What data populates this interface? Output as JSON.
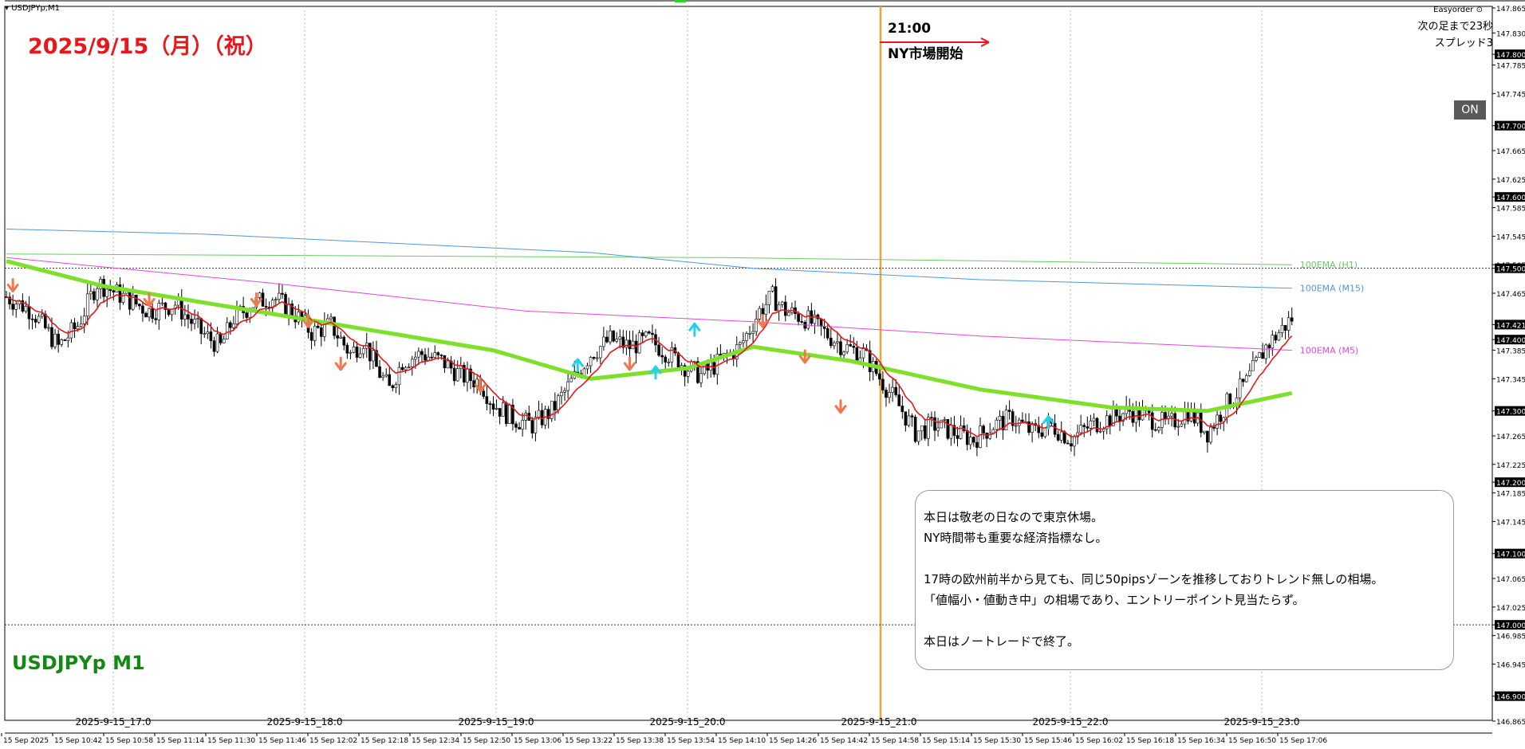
{
  "window": {
    "symbol_title": "USDJPYp,M1",
    "addon": "Easyorder"
  },
  "chart_data": {
    "type": "candlestick",
    "symbol": "USDJPYp",
    "timeframe": "M1",
    "ylim": [
      146.865,
      147.865
    ],
    "y_ticks": [
      "147.865",
      "147.830",
      "147.800",
      "147.785",
      "147.745",
      "147.700",
      "147.665",
      "147.625",
      "147.600",
      "147.585",
      "147.545",
      "147.505",
      "147.500",
      "147.465",
      "147.421",
      "147.400",
      "147.385",
      "147.345",
      "147.300",
      "147.265",
      "147.225",
      "147.200",
      "147.185",
      "147.145",
      "147.100",
      "147.065",
      "147.025",
      "147.000",
      "146.985",
      "146.945",
      "146.900",
      "146.865"
    ],
    "y_ticks_highlight": [
      "147.800",
      "147.700",
      "147.600",
      "147.500",
      "147.421",
      "147.400",
      "147.300",
      "147.200",
      "147.100",
      "147.000",
      "146.900"
    ],
    "x_ticks": [
      "15 Sep 2025",
      "15 Sep 10:42",
      "15 Sep 10:58",
      "15 Sep 11:14",
      "15 Sep 11:30",
      "15 Sep 11:46",
      "15 Sep 12:02",
      "15 Sep 12:18",
      "15 Sep 12:34",
      "15 Sep 12:50",
      "15 Sep 13:06",
      "15 Sep 13:22",
      "15 Sep 13:38",
      "15 Sep 13:54",
      "15 Sep 14:10",
      "15 Sep 14:26",
      "15 Sep 14:42",
      "15 Sep 14:58",
      "15 Sep 15:14",
      "15 Sep 15:30",
      "15 Sep 15:46",
      "15 Sep 16:02",
      "15 Sep 16:18",
      "15 Sep 16:34",
      "15 Sep 16:50",
      "15 Sep 17:06"
    ],
    "session_labels": [
      "2025-9-15_17:0",
      "2025-9-15_18:0",
      "2025-9-15_19:0",
      "2025-9-15_20:0",
      "2025-9-15_21:0",
      "2025-9-15_22:0",
      "2025-9-15_23:0"
    ],
    "price_path_nodes": [
      [
        0,
        147.46
      ],
      [
        8,
        147.44
      ],
      [
        16,
        147.39
      ],
      [
        22,
        147.42
      ],
      [
        28,
        147.48
      ],
      [
        36,
        147.46
      ],
      [
        44,
        147.44
      ],
      [
        52,
        147.45
      ],
      [
        60,
        147.41
      ],
      [
        66,
        147.39
      ],
      [
        70,
        147.43
      ],
      [
        76,
        147.45
      ],
      [
        82,
        147.46
      ],
      [
        88,
        147.44
      ],
      [
        94,
        147.41
      ],
      [
        100,
        147.42
      ],
      [
        106,
        147.38
      ],
      [
        110,
        147.4
      ],
      [
        114,
        147.36
      ],
      [
        118,
        147.33
      ],
      [
        122,
        147.37
      ],
      [
        128,
        147.38
      ],
      [
        134,
        147.37
      ],
      [
        140,
        147.35
      ],
      [
        146,
        147.34
      ],
      [
        150,
        147.31
      ],
      [
        156,
        147.29
      ],
      [
        162,
        147.28
      ],
      [
        168,
        147.3
      ],
      [
        174,
        147.34
      ],
      [
        180,
        147.38
      ],
      [
        186,
        147.4
      ],
      [
        192,
        147.39
      ],
      [
        198,
        147.4
      ],
      [
        204,
        147.38
      ],
      [
        210,
        147.36
      ],
      [
        214,
        147.35
      ],
      [
        220,
        147.37
      ],
      [
        226,
        147.39
      ],
      [
        232,
        147.44
      ],
      [
        236,
        147.46
      ],
      [
        240,
        147.44
      ],
      [
        246,
        147.43
      ],
      [
        252,
        147.41
      ],
      [
        258,
        147.39
      ],
      [
        264,
        147.38
      ],
      [
        270,
        147.34
      ],
      [
        276,
        147.3
      ],
      [
        280,
        147.27
      ],
      [
        286,
        147.28
      ],
      [
        292,
        147.27
      ],
      [
        298,
        147.26
      ],
      [
        304,
        147.28
      ],
      [
        310,
        147.29
      ],
      [
        316,
        147.27
      ],
      [
        322,
        147.28
      ],
      [
        328,
        147.26
      ],
      [
        334,
        147.28
      ],
      [
        340,
        147.29
      ],
      [
        346,
        147.3
      ],
      [
        352,
        147.29
      ],
      [
        358,
        147.28
      ],
      [
        364,
        147.3
      ],
      [
        370,
        147.27
      ],
      [
        376,
        147.31
      ],
      [
        382,
        147.34
      ],
      [
        388,
        147.39
      ],
      [
        392,
        147.41
      ],
      [
        396,
        147.43
      ]
    ],
    "series": [
      {
        "name": "100EMA (H1)",
        "color": "#66cc66",
        "points": [
          [
            0,
            147.52
          ],
          [
            220,
            147.515
          ],
          [
            396,
            147.505
          ]
        ]
      },
      {
        "name": "100EMA (M15)",
        "color": "#4f97e0",
        "points": [
          [
            0,
            147.555
          ],
          [
            60,
            147.548
          ],
          [
            120,
            147.535
          ],
          [
            180,
            147.522
          ],
          [
            230,
            147.5
          ],
          [
            300,
            147.484
          ],
          [
            396,
            147.472
          ]
        ]
      },
      {
        "name": "100EMA (M5)",
        "color": "#e048e0",
        "points": [
          [
            0,
            147.515
          ],
          [
            80,
            147.48
          ],
          [
            160,
            147.44
          ],
          [
            230,
            147.425
          ],
          [
            300,
            147.405
          ],
          [
            396,
            147.385
          ]
        ]
      },
      {
        "color": "#7ee02a",
        "points": [
          [
            0,
            147.51
          ],
          [
            30,
            147.475
          ],
          [
            70,
            147.445
          ],
          [
            110,
            147.415
          ],
          [
            150,
            147.385
          ],
          [
            180,
            147.345
          ],
          [
            210,
            147.36
          ],
          [
            230,
            147.39
          ],
          [
            260,
            147.37
          ],
          [
            300,
            147.33
          ],
          [
            340,
            147.305
          ],
          [
            370,
            147.3
          ],
          [
            396,
            147.325
          ]
        ]
      }
    ],
    "arrows_down": [
      [
        2,
        147.47
      ],
      [
        44,
        147.45
      ],
      [
        77,
        147.45
      ],
      [
        93,
        147.42
      ],
      [
        103,
        147.36
      ],
      [
        146,
        147.33
      ],
      [
        192,
        147.36
      ],
      [
        233,
        147.42
      ],
      [
        246,
        147.37
      ],
      [
        257,
        147.3
      ]
    ],
    "arrows_up": [
      [
        176,
        147.37
      ],
      [
        200,
        147.36
      ],
      [
        212,
        147.42
      ],
      [
        321,
        147.29
      ]
    ],
    "hlines": [
      147.5,
      147.0
    ],
    "vline_session": "2025-9-15_21:0",
    "annotation_time": "21:00",
    "annotation_label": "NY市場開始"
  },
  "labels": {
    "date_title": "2025/9/15（月）（祝）",
    "symbol_big": "USDJPYp M1",
    "next_bar": "次の足まで23秒",
    "spread": "スプレッド3",
    "on_button": "ON"
  },
  "note_lines": [
    "本日は敬老の日なので東京休場。",
    "NY時間帯も重要な経済指標なし。",
    "",
    "17時の欧州前半から見ても、同じ50pipsゾーンを推移しておりトレンド無しの相場。",
    "「値幅小・値動き中」の相場であり、エントリーポイント見当たらず。",
    "",
    "本日はノートレードで終了。"
  ],
  "colors": {
    "date_title": "#e8171b",
    "symbol_big": "#128a12",
    "ema_fast": "#e31919",
    "vertical_line": "#f4a236",
    "arrow_down": "#f07850",
    "arrow_up": "#22d0f0"
  }
}
